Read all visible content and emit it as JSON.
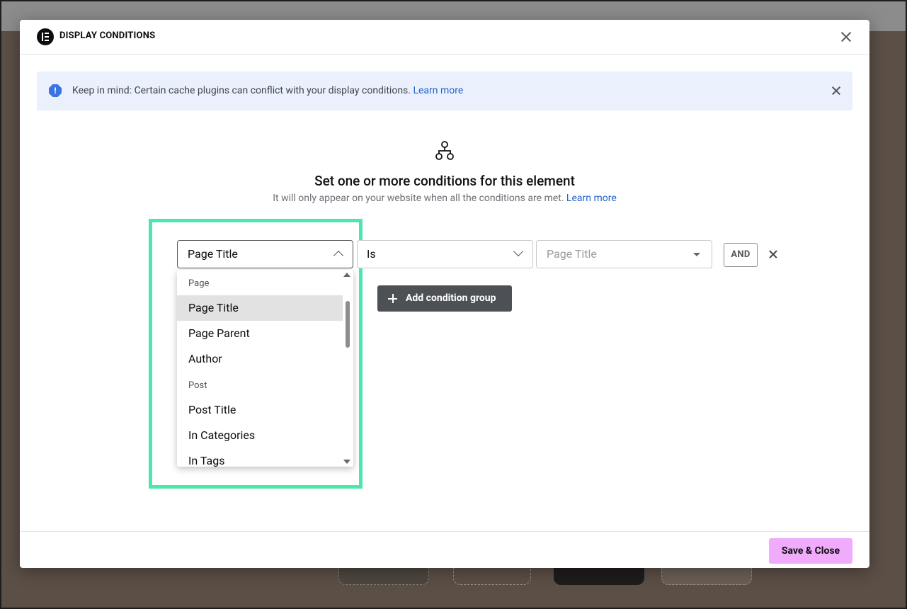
{
  "modal": {
    "title": "DISPLAY CONDITIONS"
  },
  "alert": {
    "message": "Keep in mind: Certain cache plugins can conflict with your display conditions.",
    "link": "Learn more",
    "icon_text": "!"
  },
  "intro": {
    "heading": "Set one or more conditions for this element",
    "subtext": "It will only appear on your website when all the conditions are met.",
    "link": "Learn more"
  },
  "condition_row": {
    "condition_select": "Page Title",
    "operator_select": "Is",
    "value_placeholder": "Page Title",
    "and_label": "AND"
  },
  "dropdown": {
    "groups": [
      {
        "label": "Page",
        "items": [
          "Page Title",
          "Page Parent",
          "Author"
        ]
      },
      {
        "label": "Post",
        "items": [
          "Post Title",
          "In Categories",
          "In Tags"
        ]
      }
    ],
    "selected": "Page Title"
  },
  "add_group_label": "Add condition group",
  "footer": {
    "save_label": "Save & Close"
  },
  "colors": {
    "highlight": "#4fe6ae",
    "save_button": "#f0abfc",
    "link": "#2563c9",
    "alert_bg": "#ebf1fc"
  },
  "icons": [
    "elementor-logo-icon",
    "close-icon",
    "info-icon",
    "hierarchy-icon",
    "chevron-up-icon",
    "chevron-down-icon",
    "caret-down-icon",
    "remove-icon",
    "plus-icon"
  ]
}
